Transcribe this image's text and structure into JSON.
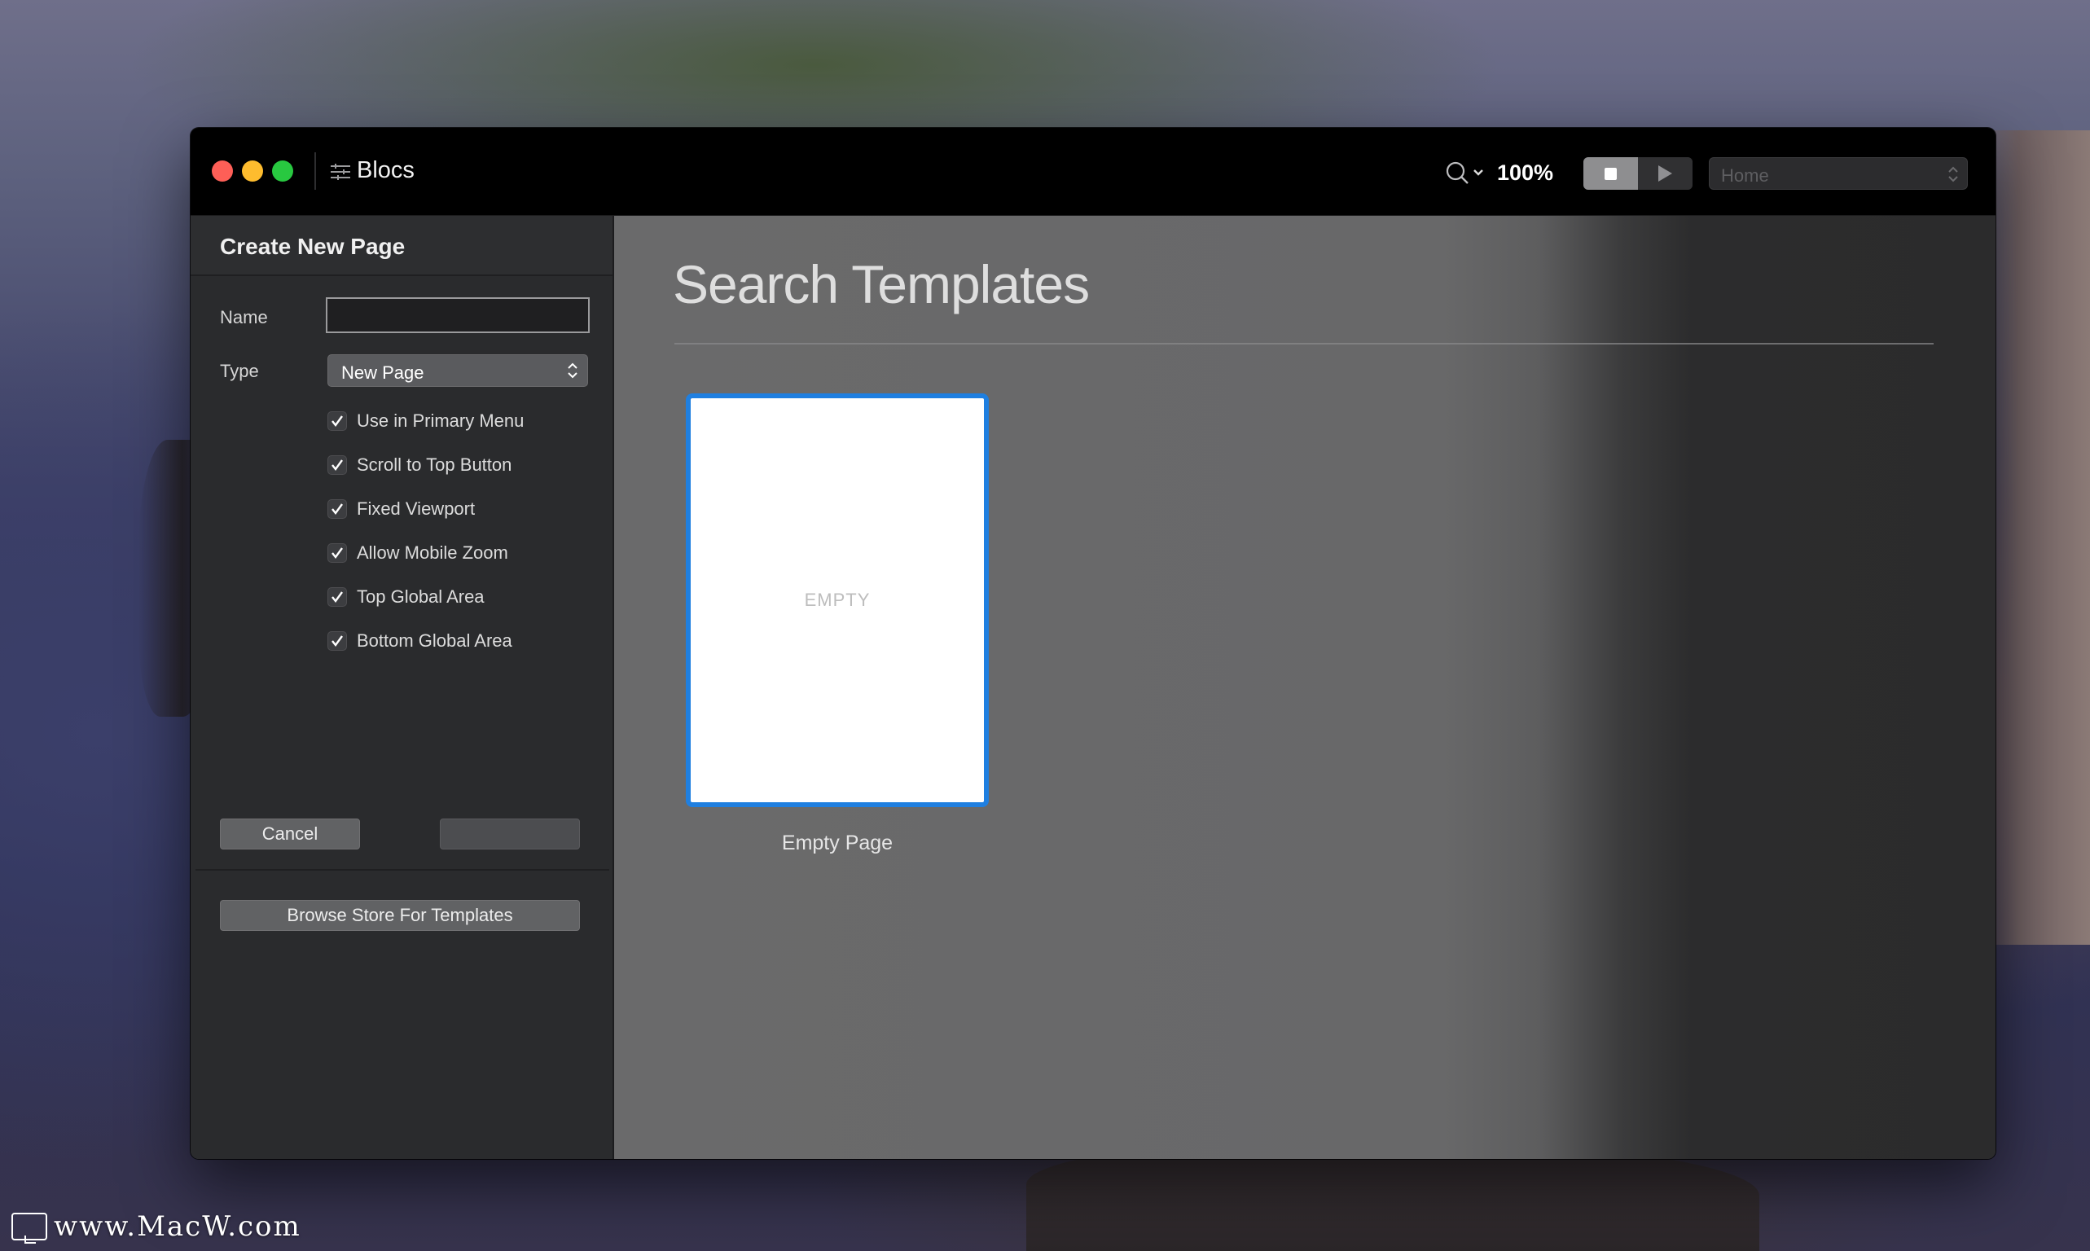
{
  "window": {
    "title": "Blocs"
  },
  "toolbar": {
    "zoom": "100%",
    "page_select": "Home"
  },
  "sheet": {
    "title": "Create New Page",
    "name_label": "Name",
    "name_value": "",
    "type_label": "Type",
    "type_value": "New Page",
    "options": [
      {
        "label": "Use in Primary Menu",
        "checked": true
      },
      {
        "label": "Scroll to Top Button",
        "checked": true
      },
      {
        "label": "Fixed Viewport",
        "checked": true
      },
      {
        "label": "Allow Mobile Zoom",
        "checked": true
      },
      {
        "label": "Top Global Area",
        "checked": true
      },
      {
        "label": "Bottom Global Area",
        "checked": true
      }
    ],
    "cancel_label": "Cancel",
    "create_label": "",
    "browse_label": "Browse Store For Templates"
  },
  "templates": {
    "heading": "Search Templates",
    "items": [
      {
        "preview_text": "EMPTY",
        "name": "Empty Page"
      }
    ]
  },
  "watermark": "www.MacW.com",
  "colors": {
    "accent": "#1f7fe0",
    "close": "#fe5f57",
    "minimize": "#febc2e",
    "maximize": "#28c840"
  }
}
